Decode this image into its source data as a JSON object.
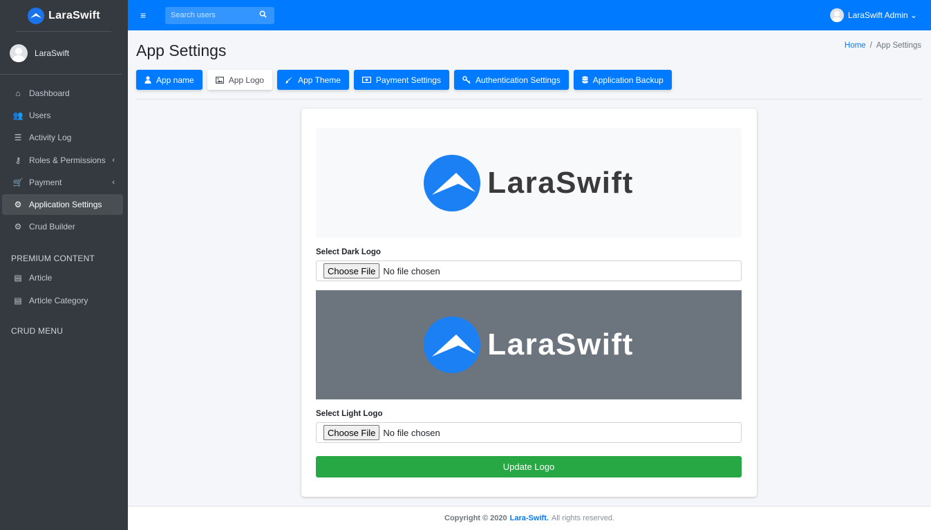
{
  "brand": {
    "name": "LaraSwift"
  },
  "sidebar": {
    "user_name": "LaraSwift",
    "items": [
      {
        "label": "Dashboard",
        "icon": "home-icon",
        "glyph": "⌂"
      },
      {
        "label": "Users",
        "icon": "users-icon",
        "glyph": "👥"
      },
      {
        "label": "Activity Log",
        "icon": "list-icon",
        "glyph": "☰"
      },
      {
        "label": "Roles & Permissions",
        "icon": "key-icon",
        "glyph": "⚷"
      },
      {
        "label": "Payment",
        "icon": "cart-icon",
        "glyph": "🛒"
      },
      {
        "label": "Application Settings",
        "icon": "gear-icon",
        "glyph": "⚙"
      },
      {
        "label": "Crud Builder",
        "icon": "gear-icon",
        "glyph": "⚙"
      }
    ],
    "premium_header": "PREMIUM CONTENT",
    "premium_items": [
      {
        "label": "Article",
        "icon": "newspaper-icon",
        "glyph": "▤"
      },
      {
        "label": "Article Category",
        "icon": "newspaper-icon",
        "glyph": "▤"
      }
    ],
    "crud_header": "CRUD MENU",
    "chevron": "‹"
  },
  "topbar": {
    "search_placeholder": "Search users",
    "user_label": "LaraSwift Admin ⌄"
  },
  "page": {
    "title": "App Settings",
    "breadcrumb_home": "Home",
    "breadcrumb_sep": "/",
    "breadcrumb_current": "App Settings"
  },
  "tabs": [
    {
      "label": "App name",
      "icon": "user-icon",
      "glyph": "👤"
    },
    {
      "label": "App Logo",
      "icon": "image-icon",
      "glyph": "🖼"
    },
    {
      "label": "App Theme",
      "icon": "brush-icon",
      "glyph": "🖌"
    },
    {
      "label": "Payment Settings",
      "icon": "money-icon",
      "glyph": "▣"
    },
    {
      "label": "Authentication Settings",
      "icon": "key-icon",
      "glyph": "⚷"
    },
    {
      "label": "Application Backup",
      "icon": "database-icon",
      "glyph": "☰"
    }
  ],
  "logo_form": {
    "logo_text": "LaraSwift",
    "dark_label": "Select Dark Logo",
    "light_label": "Select Light Logo",
    "choose_file": "Choose File",
    "no_file": "No file chosen",
    "update_button": "Update Logo"
  },
  "footer": {
    "prefix": "Copyright © 2020",
    "link": "Lara-Swift.",
    "suffix": "All rights reserved."
  },
  "colors": {
    "primary": "#007bff",
    "success": "#28a745",
    "sidebar": "#343a40"
  }
}
